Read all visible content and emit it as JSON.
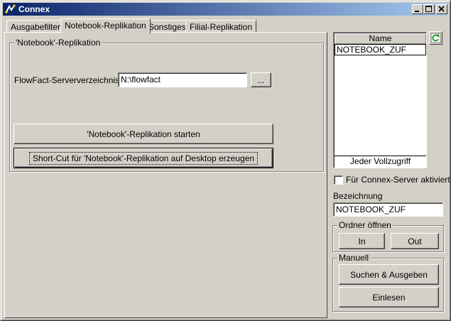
{
  "window": {
    "title": "Connex",
    "icon": "connex-app-icon",
    "controls": [
      "minimize-icon",
      "maximize-icon",
      "close-icon"
    ]
  },
  "tabs": [
    {
      "label": "Ausgabefilter",
      "active": false
    },
    {
      "label": "Notebook-Replikation",
      "active": true
    },
    {
      "label": "Sonstiges",
      "active": false
    },
    {
      "label": "Filial-Replikation",
      "active": false
    }
  ],
  "replication": {
    "group_title": "'Notebook'-Replikation",
    "server_dir_label": "FlowFact-Serververzeichnis",
    "server_dir_value": "N:\\flowfact",
    "browse_label": "...",
    "start_button": "'Notebook'-Replikation starten",
    "shortcut_button": "Short-Cut für 'Notebook'-Replikation auf Desktop erzeugen"
  },
  "sidebar": {
    "list_header": "Name",
    "list_items": [
      "NOTEBOOK_ZUF"
    ],
    "list_footer": "Jeder Vollzugriff",
    "refresh_icon": "refresh-icon",
    "server_checkbox_label": "Für Connex-Server aktiviert",
    "server_checkbox_checked": false,
    "bezeichnung_label": "Bezeichnung",
    "bezeichnung_value": "NOTEBOOK_ZUF",
    "ordner_group": "Ordner öffnen",
    "in_button": "In",
    "out_button": "Out",
    "manuell_group": "Manuell",
    "suchen_button": "Suchen & Ausgeben",
    "einlesen_button": "Einlesen"
  },
  "colors": {
    "face": "#d4d0c8",
    "title_start": "#0a246a",
    "title_end": "#a6caf0"
  }
}
